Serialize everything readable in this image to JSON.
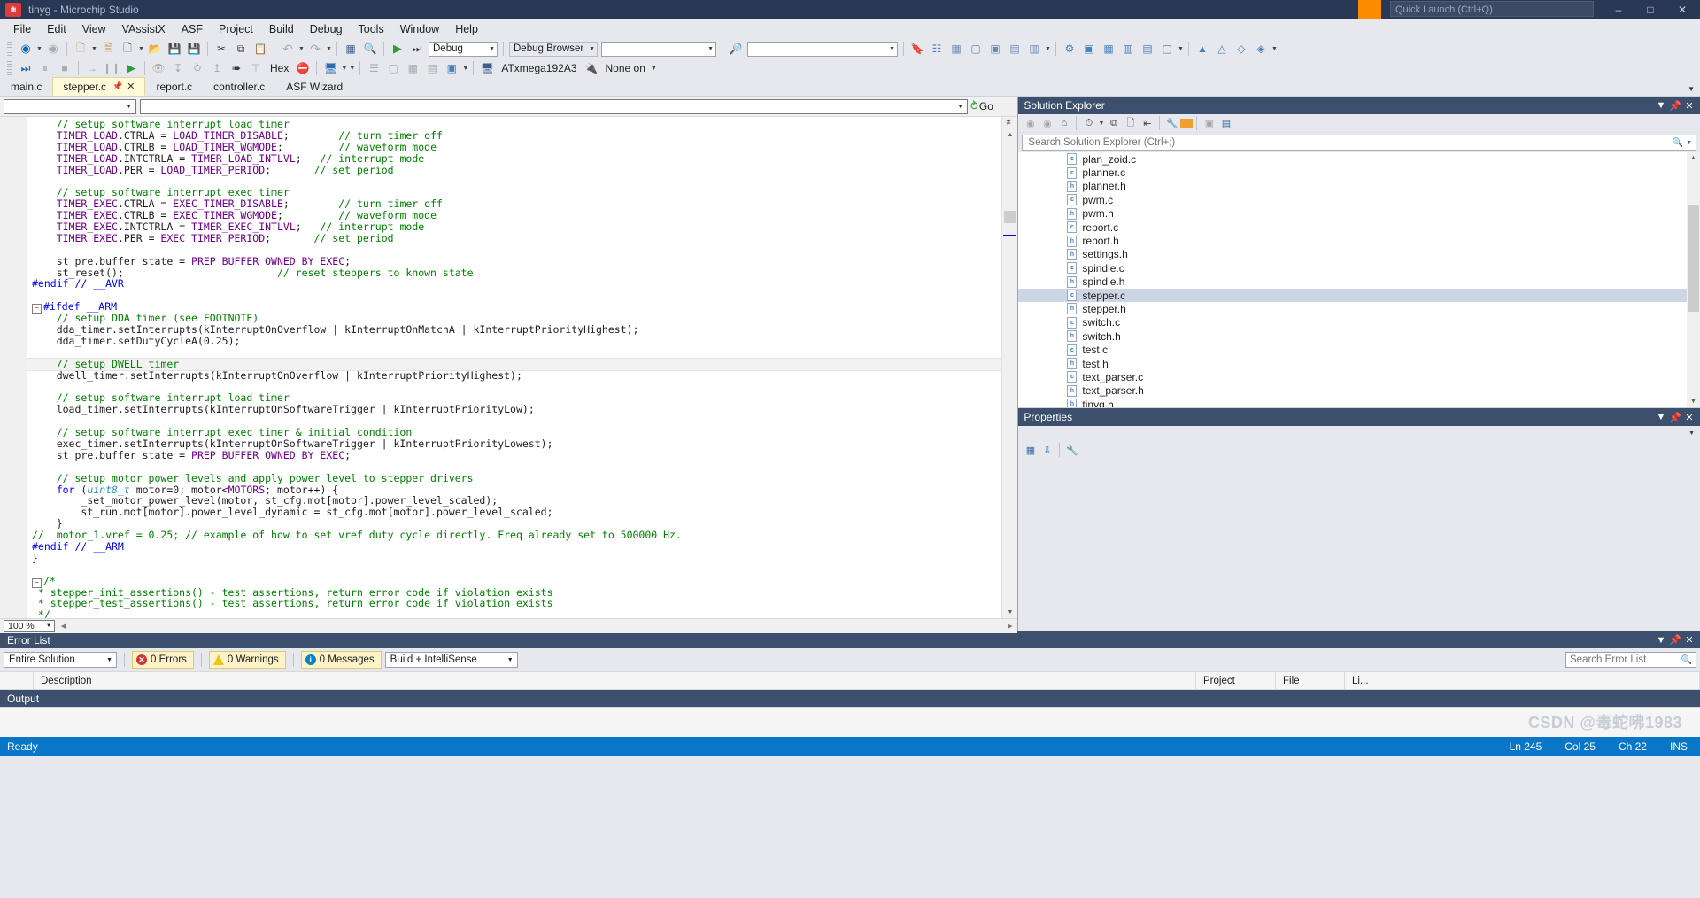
{
  "window": {
    "title": "tinyg - Microchip Studio",
    "logo_glyph": "⚙",
    "quick_launch_placeholder": "Quick Launch (Ctrl+Q)",
    "minimize": "–",
    "maximize": "□",
    "close": "✕"
  },
  "menu": {
    "items": [
      "File",
      "Edit",
      "View",
      "VAssistX",
      "ASF",
      "Project",
      "Build",
      "Debug",
      "Tools",
      "Window",
      "Help"
    ]
  },
  "toolbar1": {
    "back_icon": "◀",
    "forward_icon": "▶",
    "new_icon": "🗋",
    "open_project_icon": "📁",
    "new_item_icon": "🗎",
    "open_file_icon": "📂",
    "save_icon": "💾",
    "save_all_icon": "💾",
    "cut_icon": "✂",
    "copy_icon": "⧉",
    "paste_icon": "📋",
    "undo_icon": "↶",
    "redo_icon": "↷",
    "solution_icon": "▦",
    "find_icon": "🔍",
    "start_icon": "▶",
    "start_debug_icon": "⏭",
    "configuration_value": "Debug",
    "debug_browser_label": "Debug Browser",
    "debug_browser_value": "",
    "find_in_files_icon": "🔎",
    "search_value": "",
    "bookmark_icon": "🔖",
    "extra_icons": [
      "▣",
      "▤",
      "▥",
      "▦",
      "▧",
      "▨"
    ]
  },
  "toolbar2": {
    "continue_icon": "⏭",
    "break_icon": "▮",
    "stop_icon": "■",
    "restart_icon": "→",
    "pause_icon": "⏸",
    "run_icon": "▶",
    "step_over_icon": "➥",
    "step_into_icon": "↓",
    "step_out_icon": "↱",
    "up_icon": "↑",
    "pointer_icon": "↖",
    "run_to_cursor_icon": "⤓",
    "hex_label": "Hex",
    "no_breakpoints_icon": "⛔",
    "window_icon": "🗔",
    "device_value": "ATxmega192A3",
    "tool_value": "None on",
    "device_icon": "🖥",
    "tool_icon": "🔌"
  },
  "document_tabs": [
    {
      "label": "main.c",
      "active": false
    },
    {
      "label": "stepper.c",
      "active": true,
      "pinned": true,
      "closable": true
    },
    {
      "label": "report.c",
      "active": false
    },
    {
      "label": "controller.c",
      "active": false
    },
    {
      "label": "ASF Wizard",
      "active": false
    }
  ],
  "navigation_bar": {
    "scope_value": "",
    "member_value": "",
    "go_label": "Go"
  },
  "editor": {
    "zoom": "100 %",
    "lines": [
      {
        "indent": 4,
        "tokens": [
          [
            "cmt",
            "// setup software interrupt load timer"
          ]
        ]
      },
      {
        "indent": 4,
        "tokens": [
          [
            "mac",
            "TIMER_LOAD"
          ],
          [
            "pl",
            ".CTRLA = "
          ],
          [
            "mac",
            "LOAD_TIMER_DISABLE"
          ],
          [
            "pl",
            ";"
          ],
          [
            "gap",
            "        "
          ],
          [
            "cmt",
            "// turn timer off"
          ]
        ]
      },
      {
        "indent": 4,
        "tokens": [
          [
            "mac",
            "TIMER_LOAD"
          ],
          [
            "pl",
            ".CTRLB = "
          ],
          [
            "mac",
            "LOAD_TIMER_WGMODE"
          ],
          [
            "pl",
            ";"
          ],
          [
            "gap",
            "         "
          ],
          [
            "cmt",
            "// waveform mode"
          ]
        ]
      },
      {
        "indent": 4,
        "tokens": [
          [
            "mac",
            "TIMER_LOAD"
          ],
          [
            "pl",
            ".INTCTRLA = "
          ],
          [
            "mac",
            "TIMER_LOAD_INTLVL"
          ],
          [
            "pl",
            ";"
          ],
          [
            "gap",
            "   "
          ],
          [
            "cmt",
            "// interrupt mode"
          ]
        ]
      },
      {
        "indent": 4,
        "tokens": [
          [
            "mac",
            "TIMER_LOAD"
          ],
          [
            "pl",
            ".PER = "
          ],
          [
            "mac",
            "LOAD_TIMER_PERIOD"
          ],
          [
            "pl",
            ";"
          ],
          [
            "gap",
            "       "
          ],
          [
            "cmt",
            "// set period"
          ]
        ]
      },
      {
        "indent": 0,
        "tokens": []
      },
      {
        "indent": 4,
        "tokens": [
          [
            "cmt",
            "// setup software interrupt exec timer"
          ]
        ]
      },
      {
        "indent": 4,
        "tokens": [
          [
            "mac",
            "TIMER_EXEC"
          ],
          [
            "pl",
            ".CTRLA = "
          ],
          [
            "mac",
            "EXEC_TIMER_DISABLE"
          ],
          [
            "pl",
            ";"
          ],
          [
            "gap",
            "        "
          ],
          [
            "cmt",
            "// turn timer off"
          ]
        ]
      },
      {
        "indent": 4,
        "tokens": [
          [
            "mac",
            "TIMER_EXEC"
          ],
          [
            "pl",
            ".CTRLB = "
          ],
          [
            "mac",
            "EXEC_TIMER_WGMODE"
          ],
          [
            "pl",
            ";"
          ],
          [
            "gap",
            "         "
          ],
          [
            "cmt",
            "// waveform mode"
          ]
        ]
      },
      {
        "indent": 4,
        "tokens": [
          [
            "mac",
            "TIMER_EXEC"
          ],
          [
            "pl",
            ".INTCTRLA = "
          ],
          [
            "mac",
            "TIMER_EXEC_INTLVL"
          ],
          [
            "pl",
            ";"
          ],
          [
            "gap",
            "   "
          ],
          [
            "cmt",
            "// interrupt mode"
          ]
        ]
      },
      {
        "indent": 4,
        "tokens": [
          [
            "mac",
            "TIMER_EXEC"
          ],
          [
            "pl",
            ".PER = "
          ],
          [
            "mac",
            "EXEC_TIMER_PERIOD"
          ],
          [
            "pl",
            ";"
          ],
          [
            "gap",
            "       "
          ],
          [
            "cmt",
            "// set period"
          ]
        ]
      },
      {
        "indent": 0,
        "tokens": []
      },
      {
        "indent": 4,
        "tokens": [
          [
            "pl",
            "st_pre.buffer_state = "
          ],
          [
            "mac",
            "PREP_BUFFER_OWNED_BY_EXEC"
          ],
          [
            "pl",
            ";"
          ]
        ]
      },
      {
        "indent": 4,
        "tokens": [
          [
            "pl",
            "st_reset();"
          ],
          [
            "gap",
            "                         "
          ],
          [
            "cmt",
            "// reset steppers to known state"
          ]
        ]
      },
      {
        "indent": 0,
        "tokens": [
          [
            "pp",
            "#endif // __AVR"
          ]
        ]
      },
      {
        "indent": 0,
        "tokens": []
      },
      {
        "indent": 0,
        "tokens": [
          [
            "pp",
            "#ifdef __ARM"
          ]
        ],
        "fold": true
      },
      {
        "indent": 4,
        "tokens": [
          [
            "cmt",
            "// setup DDA timer (see FOOTNOTE)"
          ]
        ]
      },
      {
        "indent": 4,
        "tokens": [
          [
            "pl",
            "dda_timer.setInterrupts(kInterruptOnOverflow | kInterruptOnMatchA | kInterruptPriorityHighest);"
          ]
        ]
      },
      {
        "indent": 4,
        "tokens": [
          [
            "pl",
            "dda_timer.setDutyCycleA(0.25);"
          ]
        ]
      },
      {
        "indent": 0,
        "tokens": []
      },
      {
        "indent": 4,
        "tokens": [
          [
            "cmt",
            "// setup DWELL timer"
          ]
        ],
        "highlight": true
      },
      {
        "indent": 4,
        "tokens": [
          [
            "pl",
            "dwell_timer.setInterrupts(kInterruptOnOverflow | kInterruptPriorityHighest);"
          ]
        ]
      },
      {
        "indent": 0,
        "tokens": []
      },
      {
        "indent": 4,
        "tokens": [
          [
            "cmt",
            "// setup software interrupt load timer"
          ]
        ]
      },
      {
        "indent": 4,
        "tokens": [
          [
            "pl",
            "load_timer.setInterrupts(kInterruptOnSoftwareTrigger | kInterruptPriorityLow);"
          ]
        ]
      },
      {
        "indent": 0,
        "tokens": []
      },
      {
        "indent": 4,
        "tokens": [
          [
            "cmt",
            "// setup software interrupt exec timer & initial condition"
          ]
        ]
      },
      {
        "indent": 4,
        "tokens": [
          [
            "pl",
            "exec_timer.setInterrupts(kInterruptOnSoftwareTrigger | kInterruptPriorityLowest);"
          ]
        ]
      },
      {
        "indent": 4,
        "tokens": [
          [
            "pl",
            "st_pre.buffer_state = "
          ],
          [
            "mac",
            "PREP_BUFFER_OWNED_BY_EXEC"
          ],
          [
            "pl",
            ";"
          ]
        ]
      },
      {
        "indent": 0,
        "tokens": []
      },
      {
        "indent": 4,
        "tokens": [
          [
            "cmt",
            "// setup motor power levels and apply power level to stepper drivers"
          ]
        ]
      },
      {
        "indent": 4,
        "tokens": [
          [
            "kw",
            "for"
          ],
          [
            "pl",
            " ("
          ],
          [
            "typ",
            "uint8_t"
          ],
          [
            "pl",
            " motor=0; motor<"
          ],
          [
            "mac",
            "MOTORS"
          ],
          [
            "pl",
            "; motor++) {"
          ]
        ]
      },
      {
        "indent": 8,
        "tokens": [
          [
            "pl",
            "_set_motor_power_level(motor, st_cfg.mot[motor].power_level_scaled);"
          ]
        ]
      },
      {
        "indent": 8,
        "tokens": [
          [
            "pl",
            "st_run.mot[motor].power_level_dynamic = st_cfg.mot[motor].power_level_scaled;"
          ]
        ]
      },
      {
        "indent": 4,
        "tokens": [
          [
            "pl",
            "}"
          ]
        ]
      },
      {
        "indent": 0,
        "tokens": [
          [
            "cmt",
            "//  motor_1.vref = 0.25; // example of how to set vref duty cycle directly. Freq already set to 500000 Hz."
          ]
        ]
      },
      {
        "indent": 0,
        "tokens": [
          [
            "pp",
            "#endif // __ARM"
          ]
        ]
      },
      {
        "indent": 0,
        "tokens": [
          [
            "pl",
            "}"
          ]
        ]
      },
      {
        "indent": 0,
        "tokens": []
      },
      {
        "indent": 0,
        "tokens": [
          [
            "cmt",
            "/*"
          ]
        ],
        "fold": true
      },
      {
        "indent": 0,
        "tokens": [
          [
            "cmt",
            " * stepper_init_assertions() - test assertions, return error code if violation exists"
          ]
        ]
      },
      {
        "indent": 0,
        "tokens": [
          [
            "cmt",
            " * stepper_test_assertions() - test assertions, return error code if violation exists"
          ]
        ]
      },
      {
        "indent": 0,
        "tokens": [
          [
            "cmt",
            " */"
          ]
        ]
      }
    ]
  },
  "solution_explorer": {
    "title": "Solution Explorer",
    "toolbar_icons": [
      "back-icon",
      "forward-icon",
      "home-icon",
      "pending-changes-icon",
      "sync-icon",
      "refresh-icon",
      "properties-icon",
      "collapse-icon",
      "show-all-icon",
      "view-code-icon"
    ],
    "search_placeholder": "Search Solution Explorer (Ctrl+;)",
    "files": [
      {
        "name": "plan_zoid.c",
        "type": "c",
        "selected": false
      },
      {
        "name": "planner.c",
        "type": "c",
        "selected": false
      },
      {
        "name": "planner.h",
        "type": "h",
        "selected": false
      },
      {
        "name": "pwm.c",
        "type": "c",
        "selected": false
      },
      {
        "name": "pwm.h",
        "type": "h",
        "selected": false
      },
      {
        "name": "report.c",
        "type": "c",
        "selected": false
      },
      {
        "name": "report.h",
        "type": "h",
        "selected": false
      },
      {
        "name": "settings.h",
        "type": "h",
        "selected": false
      },
      {
        "name": "spindle.c",
        "type": "c",
        "selected": false
      },
      {
        "name": "spindle.h",
        "type": "h",
        "selected": false
      },
      {
        "name": "stepper.c",
        "type": "c",
        "selected": true
      },
      {
        "name": "stepper.h",
        "type": "h",
        "selected": false
      },
      {
        "name": "switch.c",
        "type": "c",
        "selected": false
      },
      {
        "name": "switch.h",
        "type": "h",
        "selected": false
      },
      {
        "name": "test.c",
        "type": "c",
        "selected": false
      },
      {
        "name": "test.h",
        "type": "h",
        "selected": false
      },
      {
        "name": "text_parser.c",
        "type": "c",
        "selected": false
      },
      {
        "name": "text_parser.h",
        "type": "h",
        "selected": false
      },
      {
        "name": "tinyg.h",
        "type": "h",
        "selected": false
      }
    ]
  },
  "properties": {
    "title": "Properties",
    "categorized_icon": "▦",
    "alphabetical_icon": "↓",
    "pages_icon": "🔧"
  },
  "error_list": {
    "title": "Error List",
    "scope_value": "Entire Solution",
    "errors_label": "0 Errors",
    "warnings_label": "0 Warnings",
    "messages_label": "0 Messages",
    "filter_value": "Build + IntelliSense",
    "search_placeholder": "Search Error List",
    "columns": [
      "",
      "Description",
      "Project",
      "File",
      "Li..."
    ]
  },
  "output": {
    "title": "Output",
    "watermark": "CSDN @毒蛇咈1983"
  },
  "status_bar": {
    "state": "Ready",
    "line": "Ln 245",
    "column": "Col 25",
    "character": "Ch 22",
    "insert_mode": "INS"
  }
}
